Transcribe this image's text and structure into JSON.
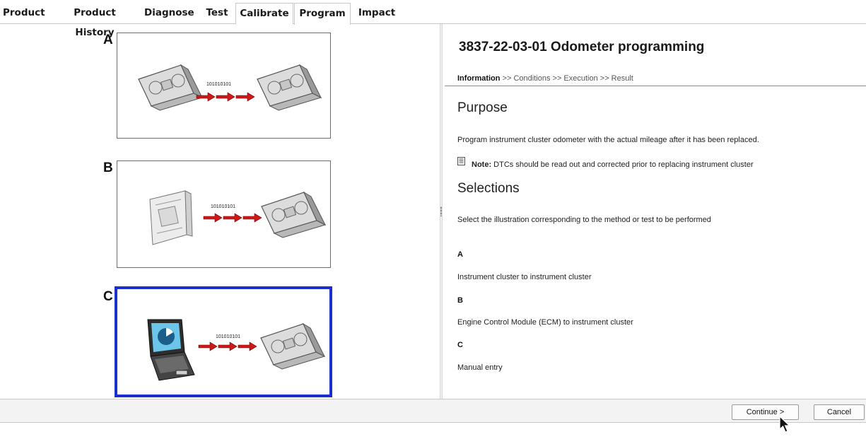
{
  "tabs": [
    {
      "label": "Product"
    },
    {
      "label": "Product History"
    },
    {
      "label": "Diagnose"
    },
    {
      "label": "Test"
    },
    {
      "label": "Calibrate"
    },
    {
      "label": "Program"
    },
    {
      "label": "Impact"
    }
  ],
  "active_tab": "Program",
  "illustrations": [
    {
      "letter": "A",
      "bits": "101010101",
      "source": "instrument-cluster",
      "target": "instrument-cluster",
      "selected": false
    },
    {
      "letter": "B",
      "bits": "101010101",
      "source": "engine-control-module",
      "target": "instrument-cluster",
      "selected": false
    },
    {
      "letter": "C",
      "bits": "101010101",
      "source": "laptop",
      "target": "instrument-cluster",
      "selected": true
    }
  ],
  "doc": {
    "title": "3837-22-03-01 Odometer programming",
    "breadcrumb": {
      "current": "Information",
      "rest": ">> Conditions >> Execution >> Result"
    },
    "purpose_heading": "Purpose",
    "purpose_text": "Program instrument cluster odometer with the actual mileage after it has been replaced.",
    "note_label": "Note:",
    "note_text": "DTCs should be read out and corrected prior to replacing instrument cluster",
    "selections_heading": "Selections",
    "selections_text": "Select the illustration corresponding to the method or test to be performed",
    "options": [
      {
        "letter": "A",
        "text": "Instrument cluster to instrument cluster"
      },
      {
        "letter": "B",
        "text": "Engine Control Module (ECM) to instrument cluster"
      },
      {
        "letter": "C",
        "text": "Manual entry"
      }
    ]
  },
  "buttons": {
    "continue": "Continue >",
    "cancel": "Cancel"
  },
  "colors": {
    "selection_border": "#1b2fd0",
    "arrow_red": "#d01818"
  }
}
